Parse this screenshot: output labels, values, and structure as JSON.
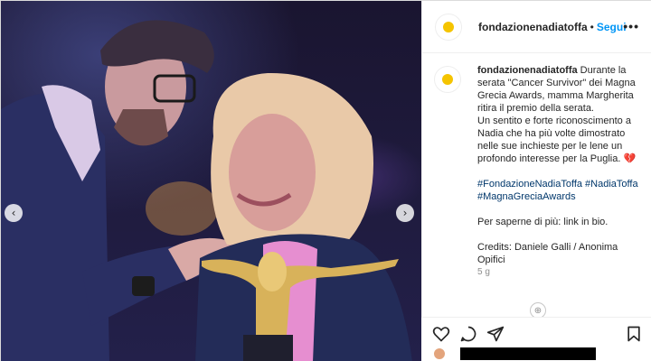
{
  "colors": {
    "link": "#0095f6",
    "hashtag": "#00376b",
    "muted": "#8e8e8e",
    "text": "#262626"
  },
  "account": {
    "username": "fondazionenadiatoffa",
    "separator": "•",
    "follow_label": "Segui",
    "more_label": "•••"
  },
  "caption": {
    "username": "fondazionenadiatoffa",
    "text_1": "Durante la serata \"Cancer Survivor\" dei Magna Grecia Awards, mamma Margherita ritira il premio della serata.",
    "text_2": "Un sentito e forte riconoscimento a Nadia che ha più volte dimostrato nelle sue inchieste per le lene un profondo interesse per la Puglia.",
    "heart": "💔",
    "hashtags": "#FondazioneNadiaToffa #NadiaToffa #MagnaGreciaAwards",
    "more_info": "Per saperne di più: link in bio.",
    "credits": "Credits: Daniele Galli / Anonima Opifici",
    "time": "5 g"
  },
  "carousel": {
    "prev_icon": "chevron-left-icon",
    "next_icon": "chevron-right-icon",
    "prev": "‹",
    "next": "›"
  },
  "actions": [
    "heart-icon",
    "comment-icon",
    "share-icon",
    "bookmark-icon"
  ]
}
